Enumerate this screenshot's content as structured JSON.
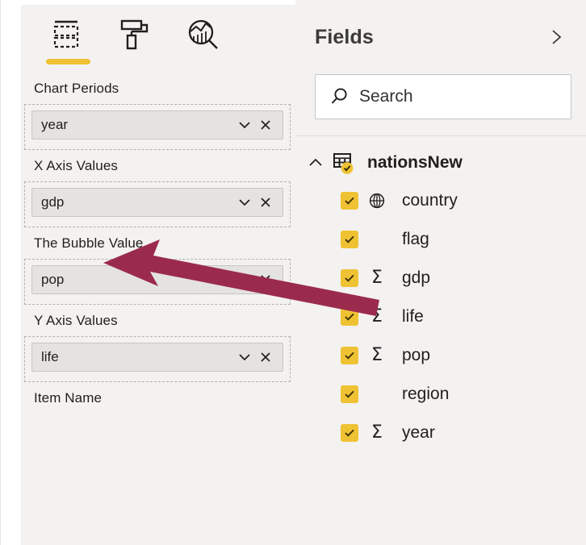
{
  "theme": {
    "accent_yellow": "#efc233",
    "panel_background": "#f3f2f1",
    "chip_background": "#e4e3e1",
    "arrow_color": "#9b2b4d",
    "text_primary": "#201f1e"
  },
  "visualizations_pane": {
    "tabs": [
      {
        "id": "fields",
        "icon": "fields-table-icon",
        "label": "Fields",
        "active": true
      },
      {
        "id": "format",
        "icon": "paint-roller-icon",
        "label": "Format",
        "active": false
      },
      {
        "id": "analytics",
        "icon": "analytics-magnifier-icon",
        "label": "Analytics",
        "active": false
      }
    ],
    "wells": [
      {
        "label": "Chart Periods",
        "chip": {
          "value": "year",
          "dropdown_icon": "chevron-down-icon",
          "remove_icon": "close-icon"
        }
      },
      {
        "label": "X Axis Values",
        "chip": {
          "value": "gdp",
          "dropdown_icon": "chevron-down-icon",
          "remove_icon": "close-icon"
        }
      },
      {
        "label": "The Bubble Value",
        "chip": {
          "value": "pop",
          "dropdown_icon": "chevron-down-icon",
          "remove_icon": "close-icon"
        }
      },
      {
        "label": "Y Axis Values",
        "chip": {
          "value": "life",
          "dropdown_icon": "chevron-down-icon",
          "remove_icon": "close-icon"
        }
      }
    ],
    "next_well_partial_label": "Item Name"
  },
  "fields_pane": {
    "title": "Fields",
    "collapse_icon": "chevron-right-icon",
    "search": {
      "placeholder": "Search",
      "value": "",
      "icon": "search-icon"
    },
    "table": {
      "name": "nationsNew",
      "expanded": true,
      "expand_icon": "chevron-up-icon",
      "icon": "table-icon",
      "badge_icon": "check-badge-icon"
    },
    "fields": [
      {
        "name": "country",
        "checked": true,
        "type_icon": "globe-icon"
      },
      {
        "name": "flag",
        "checked": true,
        "type_icon": "none"
      },
      {
        "name": "gdp",
        "checked": true,
        "type_icon": "sigma-icon"
      },
      {
        "name": "life",
        "checked": true,
        "type_icon": "sigma-icon"
      },
      {
        "name": "pop",
        "checked": true,
        "type_icon": "sigma-icon"
      },
      {
        "name": "region",
        "checked": true,
        "type_icon": "none"
      },
      {
        "name": "year",
        "checked": true,
        "type_icon": "sigma-icon"
      }
    ]
  },
  "annotation": {
    "arrow_icon": "arrow-pointer-left",
    "points_from": "gdp field checkbox in Fields list",
    "points_to": "gdp chip in X Axis Values well"
  }
}
